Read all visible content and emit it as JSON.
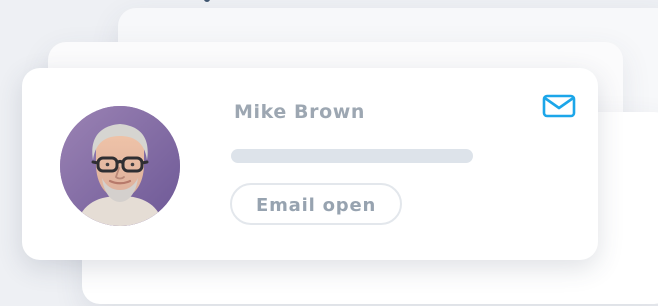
{
  "contact_card": {
    "name": "Mike Brown",
    "status_label": "Email open",
    "icon": "mail-icon",
    "accent_color": "#1ca6e9"
  }
}
